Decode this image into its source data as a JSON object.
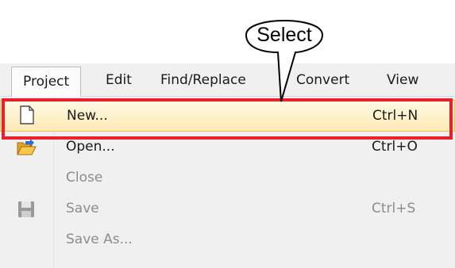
{
  "annotation": {
    "callout_text": "Select"
  },
  "menubar": {
    "items": [
      {
        "label": "Project"
      },
      {
        "label": "Edit"
      },
      {
        "label": "Find/Replace"
      },
      {
        "label": "Convert"
      },
      {
        "label": "View"
      }
    ]
  },
  "menu": {
    "items": [
      {
        "label": "New...",
        "shortcut": "Ctrl+N",
        "icon": "new-file-icon",
        "enabled": true,
        "selected": true
      },
      {
        "label": "Open...",
        "shortcut": "Ctrl+O",
        "icon": "open-folder-icon",
        "enabled": true
      },
      {
        "label": "Close",
        "shortcut": "",
        "enabled": false
      },
      {
        "label": "Save",
        "shortcut": "Ctrl+S",
        "icon": "save-icon",
        "enabled": false
      },
      {
        "label": "Save As...",
        "shortcut": "",
        "enabled": false
      }
    ]
  },
  "colors": {
    "highlight_frame": "#e8202a",
    "selected_row": "#fde9b3",
    "menu_background": "#f0f0f0"
  }
}
